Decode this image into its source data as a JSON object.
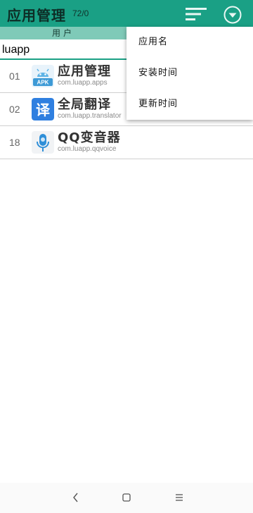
{
  "appbar": {
    "title": "应用管理",
    "count": "72/0",
    "sort_icon": "sort-lines-icon",
    "more_icon": "chevron-down-circle-icon"
  },
  "tabs": {
    "user": "用户"
  },
  "search": {
    "value": "luapp"
  },
  "apps": [
    {
      "index": "01",
      "name": "应用管理",
      "package": "com.luapp.apps",
      "icon": "apk-android-icon"
    },
    {
      "index": "02",
      "name": "全局翻译",
      "package": "com.luapp.translator",
      "icon": "translate-icon"
    },
    {
      "index": "18",
      "name": "QQ变音器",
      "package": "com.luapp.qqvoice",
      "icon": "microphone-icon"
    }
  ],
  "sort_menu": {
    "items": [
      "应用名",
      "安装时间",
      "更新时间"
    ]
  },
  "navbar": {
    "back_icon": "back-chevron-icon",
    "home_icon": "home-square-icon",
    "menu_icon": "menu-lines-icon"
  },
  "colors": {
    "primary": "#1aa085",
    "tab_bg": "#7fcab8"
  }
}
